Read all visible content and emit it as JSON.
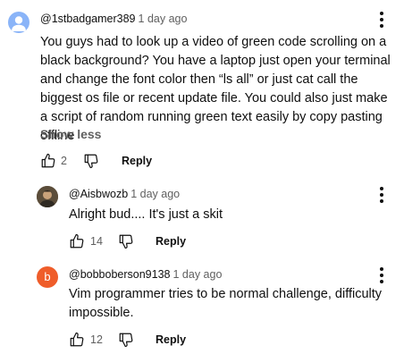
{
  "comments": [
    {
      "handle": "@1stbadgamer389",
      "time": "1 day ago",
      "text": "You guys had to look up a video of green code scrolling on a black background? You have a laptop just open your terminal and change the font color then “ls all” or just cat call the biggest os file or recent update file. You could also just make a script of random running green text easily by copy pasting offline",
      "show_less_label": "Show less",
      "likes": "2",
      "reply_label": "Reply",
      "avatar_icon": "person-silhouette-icon",
      "avatar_color": "#8ab4f8"
    },
    {
      "handle": "@Aisbwozb",
      "time": "1 day ago",
      "text": "Alright bud.... It's just a skit",
      "likes": "14",
      "reply_label": "Reply",
      "avatar_color": "#6b5b45"
    },
    {
      "handle": "@bobboberson9138",
      "time": "1 day ago",
      "text": "Vim programmer tries to be normal challenge, difficulty impossible.",
      "likes": "12",
      "reply_label": "Reply",
      "avatar_letter": "b",
      "avatar_color": "#ef5d2a"
    }
  ],
  "icons": {
    "like": "thumbs-up-icon",
    "dislike": "thumbs-down-icon",
    "menu": "more-vert-icon"
  }
}
